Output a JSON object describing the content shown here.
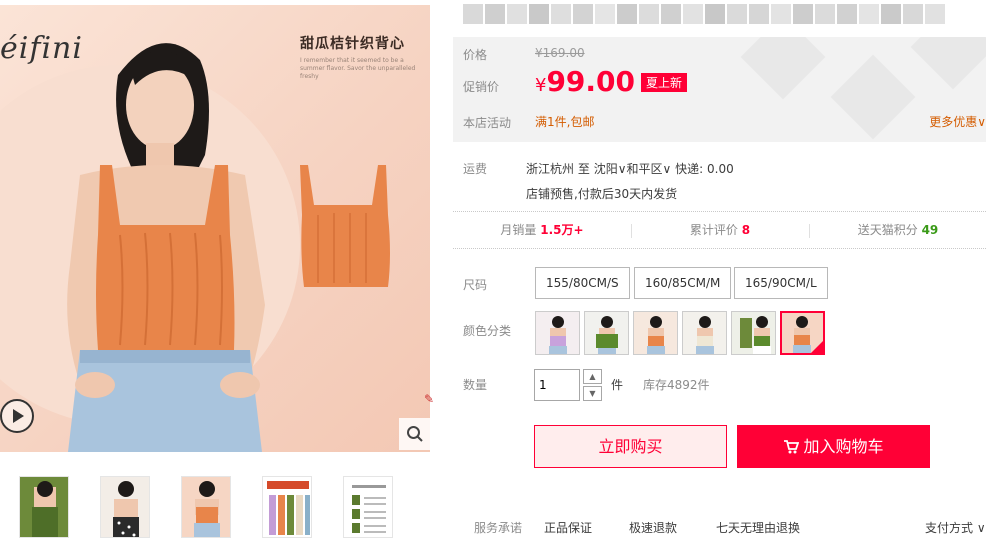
{
  "gallery": {
    "brand_logo": "éifini",
    "promo_title": "甜瓜桔针织背心",
    "promo_subtitle": "I remember that it seemed to be a summer flavor. Savor the unparalleled freshy",
    "thumbnail_count": 5
  },
  "price": {
    "original_label": "价格",
    "original_value": "¥169.00",
    "promo_label": "促销价",
    "currency": "¥",
    "promo_value": "99.00",
    "promo_tag": "夏上新",
    "shop_activity_label": "本店活动",
    "shop_activity_value": "满1件,包邮",
    "more_deals": "更多优惠"
  },
  "shipping": {
    "label": "运费",
    "origin": "浙江杭州",
    "to": "至",
    "city": "沈阳",
    "district": "和平区",
    "express": "快递: 0.00",
    "note": "店铺预售,付款后30天内发货"
  },
  "stats": {
    "monthly_sales_label": "月销量",
    "monthly_sales_value": "1.5万+",
    "reviews_label": "累计评价",
    "reviews_value": "8",
    "points_label": "送天猫积分",
    "points_value": "49"
  },
  "sku": {
    "size_label": "尺码",
    "sizes": [
      "155/80CM/S",
      "160/85CM/M",
      "165/90CM/L"
    ],
    "color_label": "颜色分类",
    "color_count": 6,
    "selected_color_index": 5
  },
  "quantity": {
    "label": "数量",
    "value": "1",
    "unit": "件",
    "stock": "库存4892件"
  },
  "actions": {
    "buy_now": "立即购买",
    "add_to_cart": "加入购物车"
  },
  "services": {
    "label": "服务承诺",
    "items": [
      "正品保证",
      "极速退款",
      "七天无理由退换"
    ],
    "payment": "支付方式"
  },
  "colors": {
    "accent": "#ff0036",
    "promo_text": "#d45c00",
    "points_green": "#3a9a18",
    "knit_orange": "#e8854a"
  }
}
